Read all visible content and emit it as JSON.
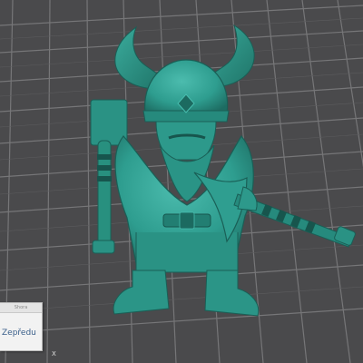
{
  "view_cube": {
    "top_label": "Shora",
    "front_label": "Zepředu"
  },
  "axis": {
    "x_label": "X"
  },
  "colors": {
    "background": "#4a4a4c",
    "grid_line": "#7a7a7c",
    "model": "#2e9d8f",
    "model_dark": "#1e6e64",
    "model_light": "#46b8a8"
  }
}
